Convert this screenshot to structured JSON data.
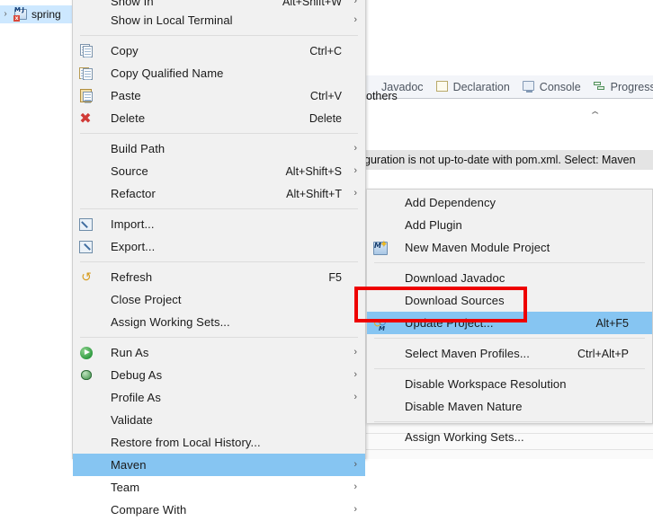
{
  "workbench": {
    "project_tree": {
      "expand_arrow": "›",
      "item_label": "spring",
      "icon": "maven-java-project-icon"
    },
    "tabs": [
      {
        "label": "Javadoc",
        "icon": "javadoc-icon"
      },
      {
        "label": "Declaration",
        "icon": "declaration-icon"
      },
      {
        "label": "Console",
        "icon": "console-icon"
      },
      {
        "label": "Progress",
        "icon": "progress-icon"
      },
      {
        "label": "",
        "icon": "partial-tab-icon"
      }
    ],
    "problem_row": "guration is not up-to-date with pom.xml. Select: Maven",
    "others_label": "others",
    "collapse_chevron": "⌃"
  },
  "context_menu": {
    "items": [
      {
        "label": "Show In",
        "accel": "Alt+Shift+W",
        "submenu": "›",
        "icon": "",
        "cut_off": true
      },
      {
        "label": "Show in Local Terminal",
        "accel": "",
        "submenu": "›",
        "icon": ""
      },
      {
        "separator": true
      },
      {
        "label": "Copy",
        "accel": "Ctrl+C",
        "submenu": "",
        "icon": "copy-icon"
      },
      {
        "label": "Copy Qualified Name",
        "accel": "",
        "submenu": "",
        "icon": "copy-qualified-name-icon"
      },
      {
        "label": "Paste",
        "accel": "Ctrl+V",
        "submenu": "",
        "icon": "paste-icon"
      },
      {
        "label": "Delete",
        "accel": "Delete",
        "submenu": "",
        "icon": "delete-icon"
      },
      {
        "separator": true
      },
      {
        "label": "Build Path",
        "accel": "",
        "submenu": "›",
        "icon": ""
      },
      {
        "label": "Source",
        "accel": "Alt+Shift+S",
        "submenu": "›",
        "icon": ""
      },
      {
        "label": "Refactor",
        "accel": "Alt+Shift+T",
        "submenu": "›",
        "icon": ""
      },
      {
        "separator": true
      },
      {
        "label": "Import...",
        "accel": "",
        "submenu": "",
        "icon": "import-icon"
      },
      {
        "label": "Export...",
        "accel": "",
        "submenu": "",
        "icon": "export-icon"
      },
      {
        "separator": true
      },
      {
        "label": "Refresh",
        "accel": "F5",
        "submenu": "",
        "icon": "refresh-icon"
      },
      {
        "label": "Close Project",
        "accel": "",
        "submenu": "",
        "icon": ""
      },
      {
        "label": "Assign Working Sets...",
        "accel": "",
        "submenu": "",
        "icon": ""
      },
      {
        "separator": true
      },
      {
        "label": "Run As",
        "accel": "",
        "submenu": "›",
        "icon": "run-icon"
      },
      {
        "label": "Debug As",
        "accel": "",
        "submenu": "›",
        "icon": "debug-icon"
      },
      {
        "label": "Profile As",
        "accel": "",
        "submenu": "›",
        "icon": ""
      },
      {
        "label": "Validate",
        "accel": "",
        "submenu": "",
        "icon": ""
      },
      {
        "label": "Restore from Local History...",
        "accel": "",
        "submenu": "",
        "icon": ""
      },
      {
        "label": "Maven",
        "accel": "",
        "submenu": "›",
        "icon": "",
        "selected": true
      },
      {
        "label": "Team",
        "accel": "",
        "submenu": "›",
        "icon": ""
      },
      {
        "label": "Compare With",
        "accel": "",
        "submenu": "›",
        "icon": ""
      }
    ]
  },
  "maven_submenu": {
    "items": [
      {
        "label": "Add Dependency",
        "accel": "",
        "icon": ""
      },
      {
        "label": "Add Plugin",
        "accel": "",
        "icon": ""
      },
      {
        "label": "New Maven Module Project",
        "accel": "",
        "icon": "new-maven-module-project-icon"
      },
      {
        "separator": true
      },
      {
        "label": "Download Javadoc",
        "accel": "",
        "icon": ""
      },
      {
        "label": "Download Sources",
        "accel": "",
        "icon": ""
      },
      {
        "label": "Update Project...",
        "accel": "Alt+F5",
        "icon": "update-project-icon",
        "selected": true
      },
      {
        "separator": true
      },
      {
        "label": "Select Maven Profiles...",
        "accel": "Ctrl+Alt+P",
        "icon": ""
      },
      {
        "separator": true
      },
      {
        "label": "Disable Workspace Resolution",
        "accel": "",
        "icon": ""
      },
      {
        "label": "Disable Maven Nature",
        "accel": "",
        "icon": ""
      },
      {
        "separator": true
      },
      {
        "label": "Assign Working Sets...",
        "accel": "",
        "icon": ""
      }
    ]
  },
  "annotation": {
    "highlight_color": "#ee0000",
    "target": "Update Project..."
  },
  "colors": {
    "menu_bg": "#f1f1f1",
    "selection_blue": "#86c5f2",
    "tree_selection": "#cde8ff",
    "annotation_red": "#ee0000"
  }
}
